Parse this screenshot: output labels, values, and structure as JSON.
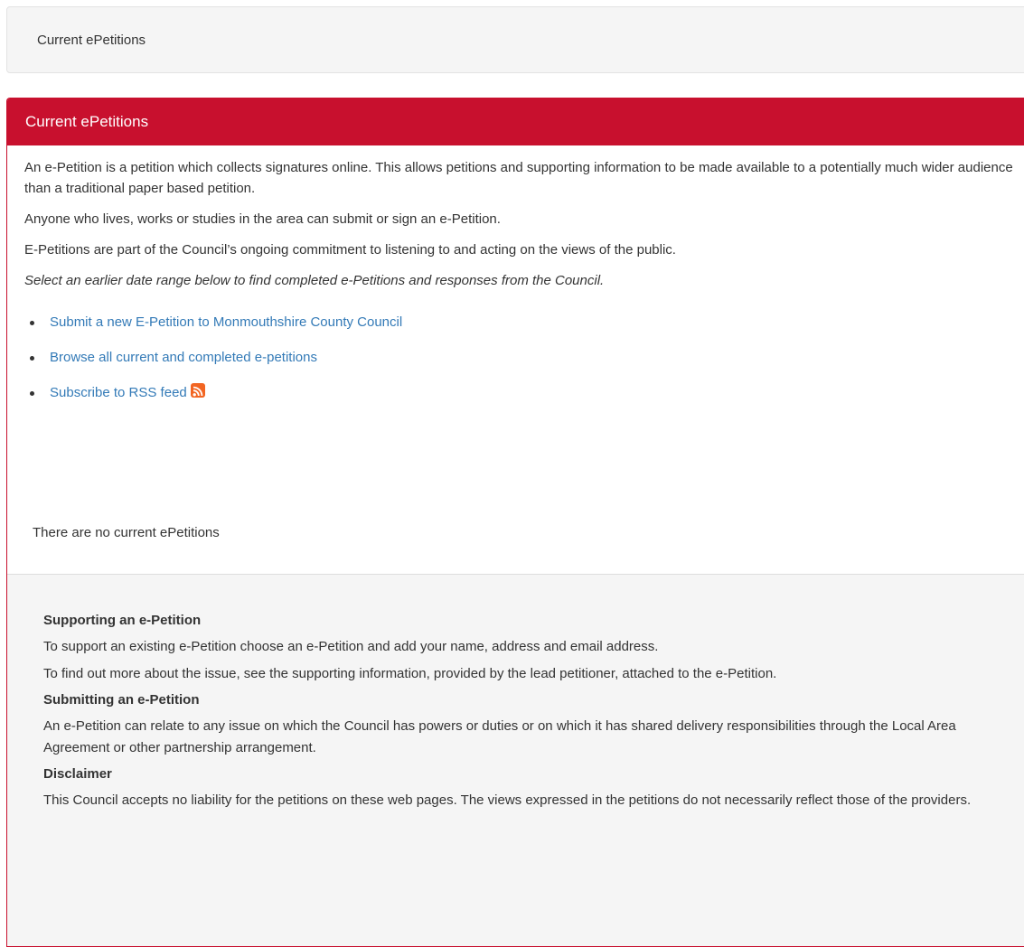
{
  "breadcrumb": {
    "label": "Current ePetitions"
  },
  "panel": {
    "heading": "Current ePetitions",
    "paragraphs": [
      "An e-Petition is a petition which collects signatures online. This allows petitions and supporting information to be made available to a potentially much wider audience than a traditional paper based petition.",
      "Anyone who lives, works or studies in the area can submit or sign an e-Petition.",
      "E-Petitions are part of the Council’s ongoing commitment to listening to and acting on the views of the public.",
      "Select an earlier date range below to find completed e-Petitions and responses from the Council."
    ],
    "links": [
      {
        "label": "Submit a new E-Petition to Monmouthshire County Council"
      },
      {
        "label": "Browse all current and completed e-petitions"
      },
      {
        "label": "Subscribe to RSS feed",
        "icon": "rss-icon"
      }
    ],
    "empty_message": "There are no current ePetitions"
  },
  "footer": {
    "sections": [
      {
        "title": "Supporting an e-Petition",
        "paragraphs": [
          "To support an existing e-Petition choose an e-Petition and add your name, address and email address.",
          "To find out more about the issue, see the supporting information, provided by the lead petitioner, attached to the e-Petition."
        ]
      },
      {
        "title": "Submitting an e-Petition",
        "paragraphs": [
          "An e-Petition can relate to any issue on which the Council has powers or duties or on which it has shared delivery responsibilities through the Local Area Agreement or other partnership arrangement."
        ]
      },
      {
        "title": "Disclaimer",
        "paragraphs": [
          "This Council accepts no liability for the petitions on these web pages. The views expressed in the petitions do not necessarily reflect those of the providers."
        ]
      }
    ]
  },
  "colors": {
    "brand_red": "#c8102e",
    "link_blue": "#337ab7",
    "rss_orange": "#f26522"
  }
}
